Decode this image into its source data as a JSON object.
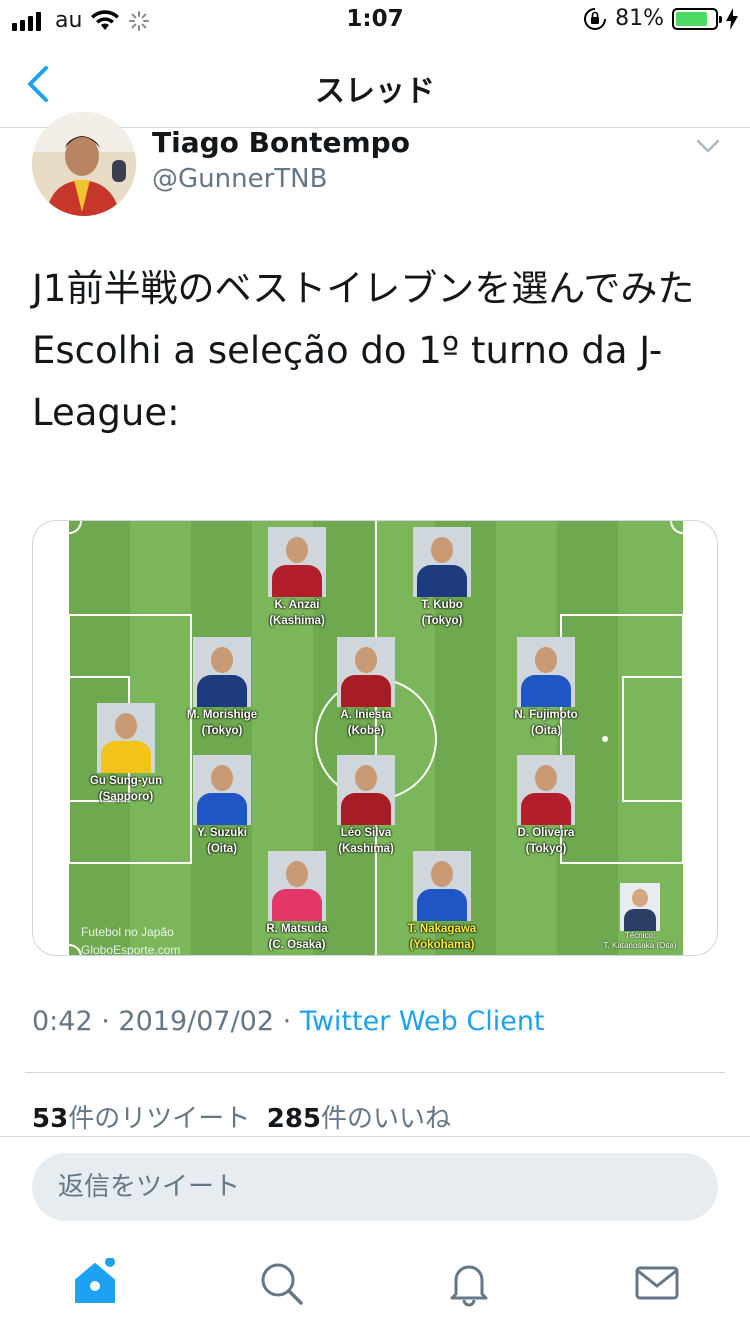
{
  "status_bar": {
    "carrier": "au",
    "time": "1:07",
    "battery_percent": "81%",
    "battery_level": 0.81
  },
  "nav": {
    "back_icon": "chevron-left-icon",
    "title": "スレッド"
  },
  "tweet": {
    "author_name": "Tiago Bontempo",
    "author_handle": "@GunnerTNB",
    "text_line1": "J1前半戦のベストイレブンを選んでみた",
    "text_line2": "Escolhi a seleção do 1º turno da J-League:",
    "time": "0:42",
    "date": "2019/07/02",
    "separator": "·",
    "client": "Twitter Web Client",
    "retweets_count": "53",
    "retweets_label": "件のリツイート",
    "likes_count": "285",
    "likes_label": "件のいいね"
  },
  "lineup": {
    "players": [
      {
        "name": "K. Anzai",
        "club": "(Kashima)"
      },
      {
        "name": "T. Kubo",
        "club": "(Tokyo)"
      },
      {
        "name": "M. Morishige",
        "club": "(Tokyo)"
      },
      {
        "name": "A. Iniesta",
        "club": "(Kobe)"
      },
      {
        "name": "N. Fujimoto",
        "club": "(Oita)"
      },
      {
        "name": "Gu Sung-yun",
        "club": "(Sapporo)"
      },
      {
        "name": "Y. Suzuki",
        "club": "(Oita)"
      },
      {
        "name": "Léo Silva",
        "club": "(Kashima)"
      },
      {
        "name": "D. Oliveira",
        "club": "(Tokyo)"
      },
      {
        "name": "R. Matsuda",
        "club": "(C. Osaka)"
      },
      {
        "name": "T. Nakagawa",
        "club": "(Yokohama)"
      }
    ],
    "coach_role": "Técnico:",
    "coach": "T. Katanosaka (Oita)",
    "watermark_line1": "Futebol no Japão",
    "watermark_line2": "GloboEsporte.com",
    "pitch_color": "#7cb65a",
    "highlight_color": "#ffea3a"
  },
  "reply": {
    "placeholder": "返信をツイート"
  },
  "tabs": [
    {
      "icon": "home-icon"
    },
    {
      "icon": "search-icon"
    },
    {
      "icon": "bell-icon"
    },
    {
      "icon": "mail-icon"
    }
  ],
  "colors": {
    "accent": "#1da1f2",
    "secondary_text": "#657786",
    "border": "#ccd6dd"
  }
}
